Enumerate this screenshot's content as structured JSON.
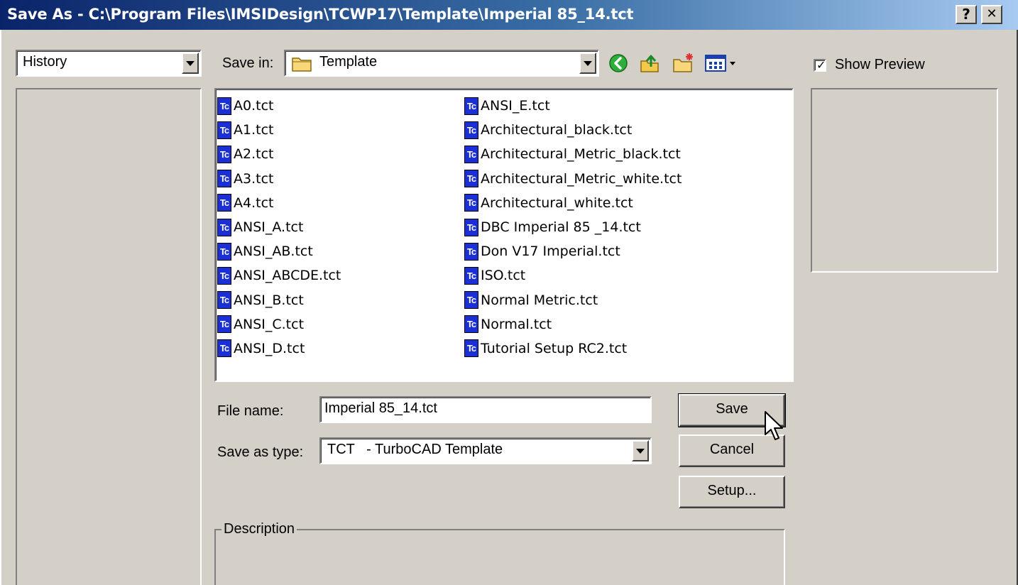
{
  "window": {
    "title": "Save As - C:\\Program Files\\IMSIDesign\\TCWP17\\Template\\Imperial 85_14.tct",
    "help_label": "?",
    "close_label": "✕"
  },
  "left_panel": {
    "combo_value": "History"
  },
  "toolbar": {
    "save_in_label": "Save in:",
    "save_in_value": "Template",
    "icons": [
      "back-icon",
      "up-folder-icon",
      "new-folder-icon",
      "view-menu-icon"
    ]
  },
  "files": {
    "column1": [
      "A0.tct",
      "A1.tct",
      "A2.tct",
      "A3.tct",
      "A4.tct",
      "ANSI_A.tct",
      "ANSI_AB.tct",
      "ANSI_ABCDE.tct",
      "ANSI_B.tct",
      "ANSI_C.tct",
      "ANSI_D.tct"
    ],
    "column2": [
      "ANSI_E.tct",
      "Architectural_black.tct",
      "Architectural_Metric_black.tct",
      "Architectural_Metric_white.tct",
      "Architectural_white.tct",
      "DBC Imperial 85 _14.tct",
      "Don V17 Imperial.tct",
      "ISO.tct",
      "Normal Metric.tct",
      "Normal.tct",
      "Tutorial Setup RC2.tct"
    ],
    "icon_text": "Tc"
  },
  "form": {
    "file_name_label": "File name:",
    "file_name_value": "Imperial 85_14.tct",
    "save_type_label": "Save as type:",
    "save_type_value": "TCT   - TurboCAD Template"
  },
  "buttons": {
    "save": "Save",
    "cancel": "Cancel",
    "setup": "Setup..."
  },
  "preview": {
    "show_preview_label": "Show Preview",
    "checked": true
  },
  "description": {
    "label": "Description"
  }
}
